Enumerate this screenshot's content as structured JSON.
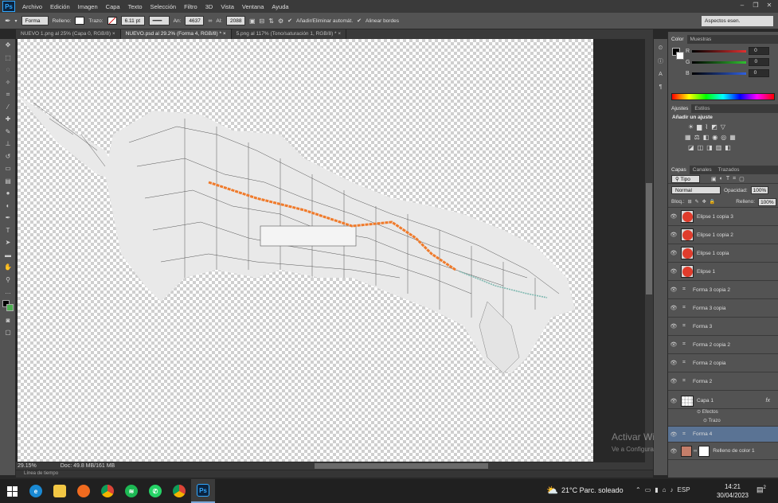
{
  "app": {
    "logo": "Ps"
  },
  "menu": [
    "Archivo",
    "Edición",
    "Imagen",
    "Capa",
    "Texto",
    "Selección",
    "Filtro",
    "3D",
    "Vista",
    "Ventana",
    "Ayuda"
  ],
  "window_controls": [
    "minimize-icon",
    "restore-icon",
    "close-icon"
  ],
  "options": {
    "shape_mode": "Forma",
    "fill_label": "Relleno:",
    "stroke_label": "Trazo:",
    "stroke_width": "6.11 pt",
    "width_label": "An:",
    "width_value": "4637 p",
    "height_label": "Al:",
    "height_value": "2088 p",
    "auto_add_label": "Añadir/Eliminar automát.",
    "align_edges_label": "Alinear bordes",
    "workspace": "Aspectos esen.",
    "fill_color": "#ffffff",
    "stroke_color": "#ffffff"
  },
  "tabs": [
    {
      "label": "NUEVO 1.png al 25% (Capa 0, RGB/8)",
      "close": "×",
      "active": false
    },
    {
      "label": "NUEVO.psd al 29.2% (Forma 4, RGB/8) *",
      "close": "×",
      "active": true
    },
    {
      "label": "5.png al 117% (Tono/saturación 1, RGB/8) *",
      "close": "×",
      "active": false
    }
  ],
  "status": {
    "zoom": "29.15%",
    "doc": "Doc: 49.8 MB/161 MB",
    "timeline": "Línea de tiempo"
  },
  "color_panel": {
    "tabs": [
      "Color",
      "Muestras"
    ],
    "channels": [
      {
        "label": "R",
        "value": "0",
        "color": "#e03030"
      },
      {
        "label": "G",
        "value": "0",
        "color": "#30c030"
      },
      {
        "label": "B",
        "value": "0",
        "color": "#3060e0"
      }
    ],
    "foreground": "#000000",
    "background": "#ffffff"
  },
  "adjustments_panel": {
    "tabs": [
      "Ajustes",
      "Estilos"
    ],
    "heading": "Añadir un ajuste"
  },
  "layers_panel": {
    "tabs": [
      "Capas",
      "Canales",
      "Trazados"
    ],
    "filter": "Tipo",
    "blend_mode": "Normal",
    "opacity_label": "Opacidad:",
    "opacity": "100%",
    "lock_label": "Bloq.:",
    "fill_label": "Relleno:",
    "fill": "100%",
    "ellipse_color": "#e03c2c",
    "layers": [
      {
        "name": "Elipse 1 copia 3",
        "kind": "ellipse"
      },
      {
        "name": "Elipse 1 copia 2",
        "kind": "ellipse"
      },
      {
        "name": "Elipse 1 copia",
        "kind": "ellipse"
      },
      {
        "name": "Elipse 1",
        "kind": "ellipse"
      },
      {
        "name": "Forma 3 copia 2",
        "kind": "shape"
      },
      {
        "name": "Forma 3 copia",
        "kind": "shape"
      },
      {
        "name": "Forma 3",
        "kind": "shape"
      },
      {
        "name": "Forma 2 copia 2",
        "kind": "shape"
      },
      {
        "name": "Forma 2 copia",
        "kind": "shape"
      },
      {
        "name": "Forma 2",
        "kind": "shape"
      },
      {
        "name": "Forma 1",
        "kind": "shape"
      }
    ],
    "capa1": {
      "name": "Capa 1",
      "fx": "fx",
      "effects": "Efectos",
      "stroke": "Trazo"
    },
    "forma4": {
      "name": "Forma 4"
    },
    "color_fill": {
      "name": "Relleno de color 1",
      "color": "#c47e6a"
    }
  },
  "watermark": {
    "title": "Activar Windows",
    "subtitle": "Ve a Configuración para activar Windows."
  },
  "taskbar": {
    "weather": "21°C  Parc. soleado",
    "lang": "ESP",
    "time": "14:21",
    "date": "30/04/2023",
    "notifications": "2",
    "ps_label": "Ps"
  },
  "map": {
    "route_orange": "#f07a2a",
    "route_teal": "#7fb8b0",
    "backdrop": "#e9e9e9",
    "streets": "#3a3a3a"
  }
}
